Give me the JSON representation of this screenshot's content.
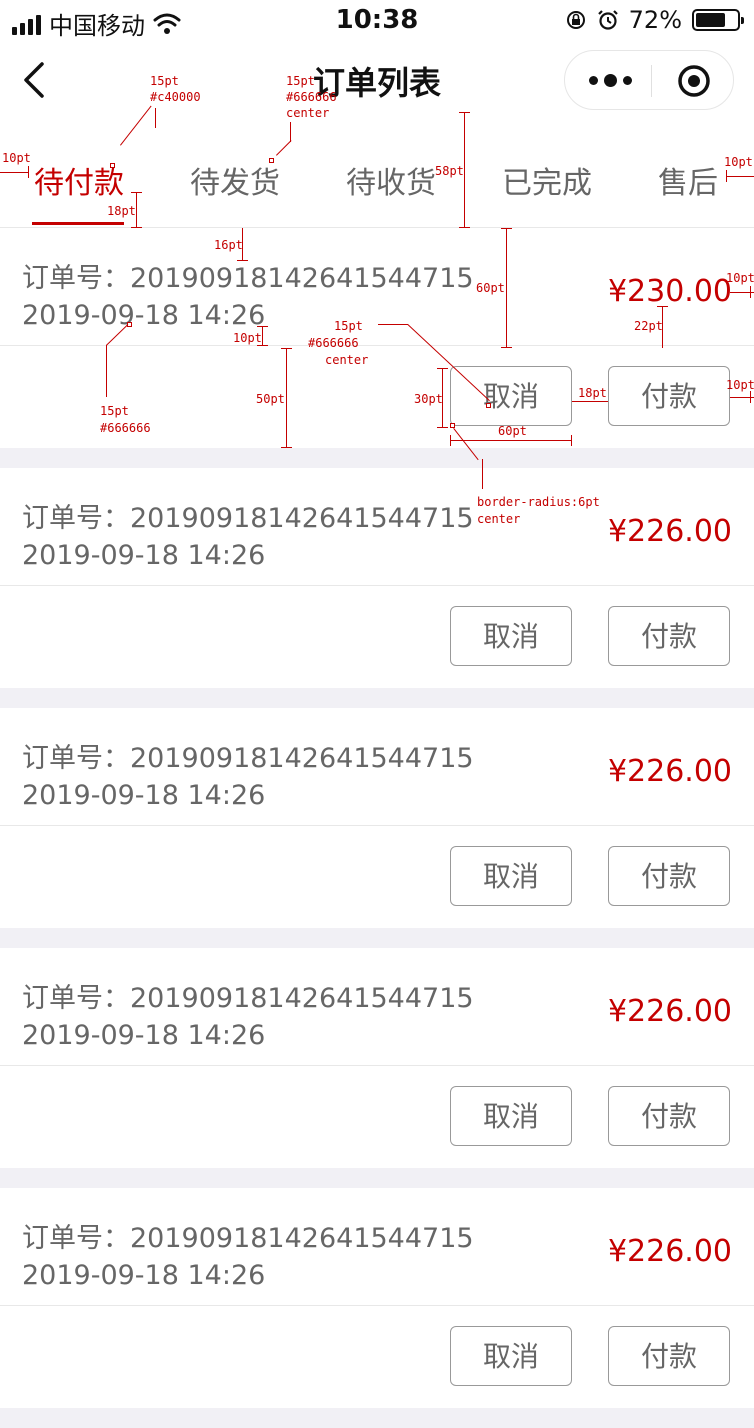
{
  "status_bar": {
    "carrier": "中国移动",
    "time": "10:38",
    "battery": "72%",
    "battery_level": 0.72
  },
  "nav": {
    "title": "订单列表"
  },
  "tabs": [
    {
      "label": "待付款",
      "active": true
    },
    {
      "label": "待发货",
      "active": false
    },
    {
      "label": "待收货",
      "active": false
    },
    {
      "label": "已完成",
      "active": false
    },
    {
      "label": "售后",
      "active": false
    }
  ],
  "orders": [
    {
      "order_no": "订单号：20190918142641544715",
      "time": "2019-09-18 14:26",
      "price": "¥230.00",
      "cancel": "取消",
      "pay": "付款"
    },
    {
      "order_no": "订单号：20190918142641544715",
      "time": "2019-09-18 14:26",
      "price": "¥226.00",
      "cancel": "取消",
      "pay": "付款"
    },
    {
      "order_no": "订单号：20190918142641544715",
      "time": "2019-09-18 14:26",
      "price": "¥226.00",
      "cancel": "取消",
      "pay": "付款"
    },
    {
      "order_no": "订单号：20190918142641544715",
      "time": "2019-09-18 14:26",
      "price": "¥226.00",
      "cancel": "取消",
      "pay": "付款"
    },
    {
      "order_no": "订单号：20190918142641544715",
      "time": "2019-09-18 14:26",
      "price": "¥226.00",
      "cancel": "取消",
      "pay": "付款"
    }
  ],
  "annotations": {
    "tab_active_font": "15pt",
    "tab_active_color": "#c40000",
    "tab_font": "15pt",
    "tab_color": "#666666",
    "tab_align": "center",
    "left_pad": "10pt",
    "right_pad": "10pt",
    "tabbar_height": "58pt",
    "underline_gap": "18pt",
    "top_gap": "16pt",
    "info_height": "60pt",
    "price_pad": "10pt",
    "price_gap": "22pt",
    "line_gap": "10pt",
    "info_font": "15pt",
    "info_color": "#666666",
    "action_height": "50pt",
    "btn_font": "15pt",
    "btn_color": "#666666",
    "btn_align": "center",
    "btn_height": "30pt",
    "btn_gap": "18pt",
    "btn_pad": "10pt",
    "btn_width": "60pt",
    "btn_radius": "border-radius:6pt",
    "btn_radius_align": "center"
  },
  "colors": {
    "accent": "#c40000",
    "text_secondary": "#666666",
    "page_bg": "#f1f0f5"
  }
}
